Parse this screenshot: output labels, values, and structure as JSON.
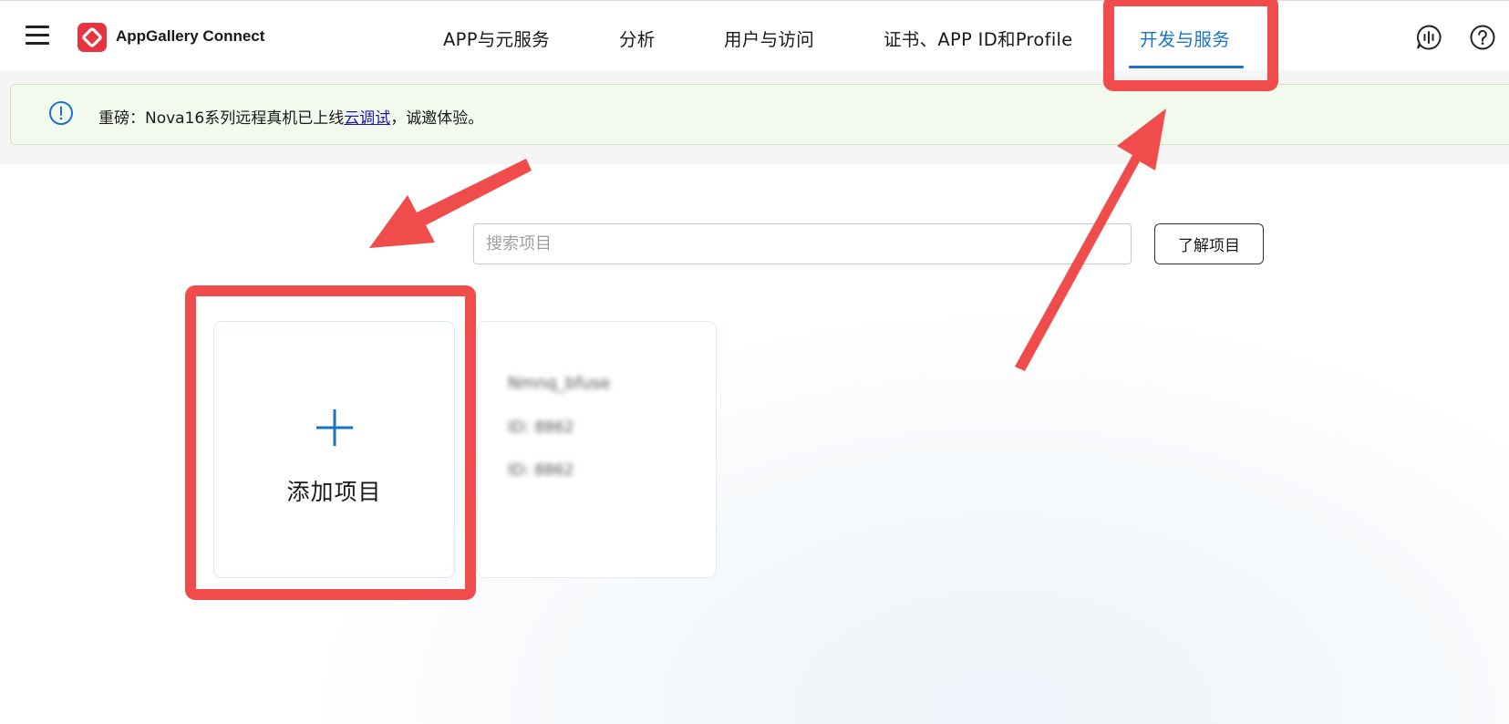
{
  "header": {
    "brand": "AppGallery Connect",
    "nav": [
      {
        "label": "APP与元服务",
        "active": false
      },
      {
        "label": "分析",
        "active": false
      },
      {
        "label": "用户与访问",
        "active": false
      },
      {
        "label": "证书、APP ID和Profile",
        "active": false
      },
      {
        "label": "开发与服务",
        "active": true
      }
    ],
    "icons": [
      "menu-icon",
      "appgallery-logo-icon",
      "voice-feedback-icon",
      "help-icon"
    ]
  },
  "notice": {
    "text_before": "重磅：Nova16系列远程真机已上线",
    "link": "云调试",
    "text_after": "，诚邀体验。",
    "icon": "info-icon"
  },
  "search": {
    "placeholder": "搜索项目",
    "value": ""
  },
  "learn_button": "了解项目",
  "add_card": {
    "label": "添加项目",
    "icon": "plus-icon"
  },
  "project_card": {
    "name": "Nmnq_bfuse",
    "line1": "ID: 8862",
    "line2": "ID: 8862"
  },
  "colors": {
    "accent": "#1a73c8",
    "annotation": "#f04c4c",
    "notice_bg": "#f3faed"
  }
}
